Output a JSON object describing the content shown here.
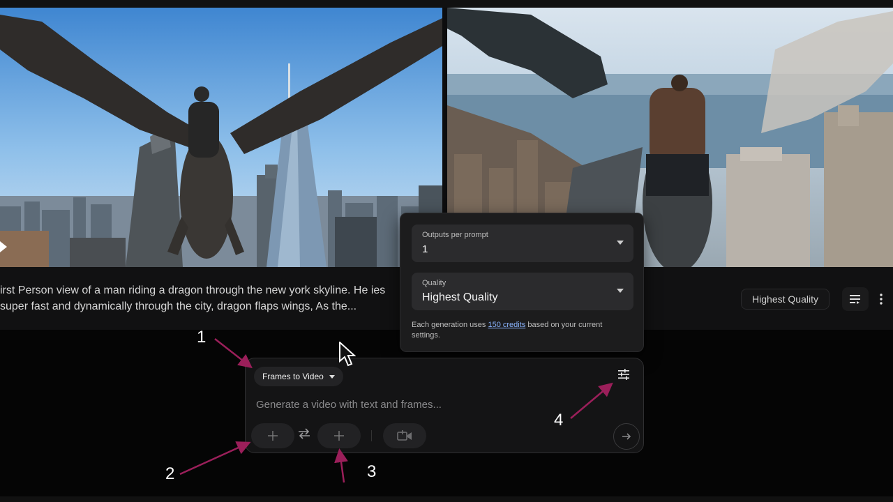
{
  "result": {
    "prompt_text": "irst Person view of a man riding a dragon through the new york skyline. He ies super fast and dynamically through the city, dragon flaps wings, As the...",
    "quality_chip": "Highest Quality",
    "images": [
      "dragon-rider-skyline-frame-left",
      "dragon-rider-skyline-frame-right"
    ]
  },
  "settings_panel": {
    "outputs": {
      "label": "Outputs per prompt",
      "value": "1"
    },
    "quality": {
      "label": "Quality",
      "value": "Highest Quality"
    },
    "credits_prefix": "Each generation uses ",
    "credits_link": "150 credits",
    "credits_suffix": " based on your current settings."
  },
  "composer": {
    "mode": "Frames to Video",
    "placeholder": "Generate a video with text and frames..."
  },
  "annotations": {
    "n1": "1",
    "n2": "2",
    "n3": "3",
    "n4": "4",
    "arrow_color": "#9b1f5a"
  },
  "icons": [
    "play-icon",
    "list-icon",
    "more-vert-icon",
    "dropdown-caret-icon",
    "tune-icon",
    "plus-icon",
    "swap-icon",
    "video-camera-icon",
    "arrow-right-icon",
    "mouse-pointer-icon"
  ]
}
